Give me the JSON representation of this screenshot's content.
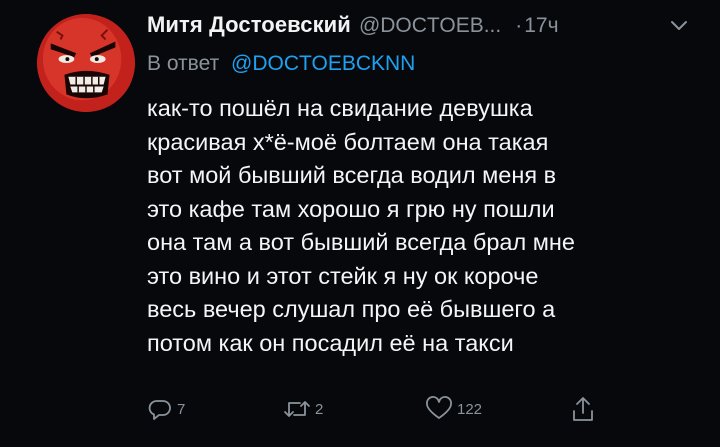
{
  "tweet": {
    "author_name": "Митя Достоевский",
    "author_handle": "@DOCTOEB...",
    "separator": "·",
    "time": "17ч",
    "reply_prefix": "В ответ",
    "reply_target": "@DOCTOEBCKNN",
    "text": "как-то пошёл на свидание девушка\nкрасивая х*ё-моё болтаем она такая\nвот мой бывший всегда водил меня в\nэто кафе там хорошо я грю ну пошли\nона там а вот бывший всегда брал мне\nэто вино и этот стейк я ну ок короче\nвесь вечер слушал про её бывшего а\nпотом как он посадил её на такси"
  },
  "actions": {
    "reply_count": "7",
    "retweet_count": "2",
    "like_count": "122",
    "icons": [
      "reply-icon",
      "retweet-icon",
      "like-icon",
      "share-icon"
    ]
  },
  "colors": {
    "background": "#07080b",
    "text": "#f4f5f7",
    "muted": "#8a939c",
    "link": "#1da1f2",
    "avatar": "#c8261f"
  }
}
